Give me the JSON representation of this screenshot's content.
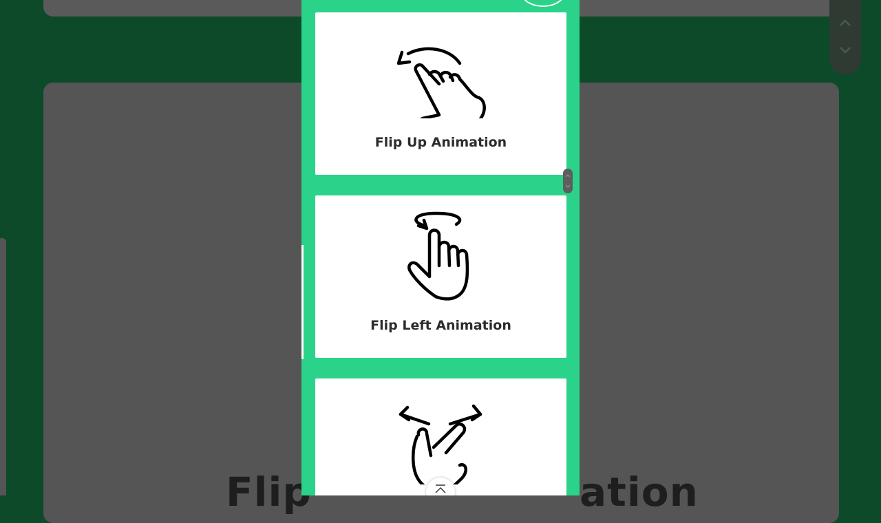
{
  "cards": [
    {
      "label": "Flip Up Animation",
      "icon": "swipe-up-hand-icon"
    },
    {
      "label": "Flip Left Animation",
      "icon": "rotate-tap-hand-icon"
    },
    {
      "label": "",
      "icon": "pinch-spread-hand-icon"
    }
  ],
  "background": {
    "heading_left": "Flip",
    "heading_right": "ation"
  },
  "colors": {
    "phone_background": "#2bd38a",
    "card_background": "#ffffff",
    "page_overlay": "#0c4a2a"
  },
  "icons": {
    "back_to_top": "chevron-up-icon",
    "bg_scroll": [
      "chevron-up-icon",
      "chevron-down-icon"
    ]
  }
}
